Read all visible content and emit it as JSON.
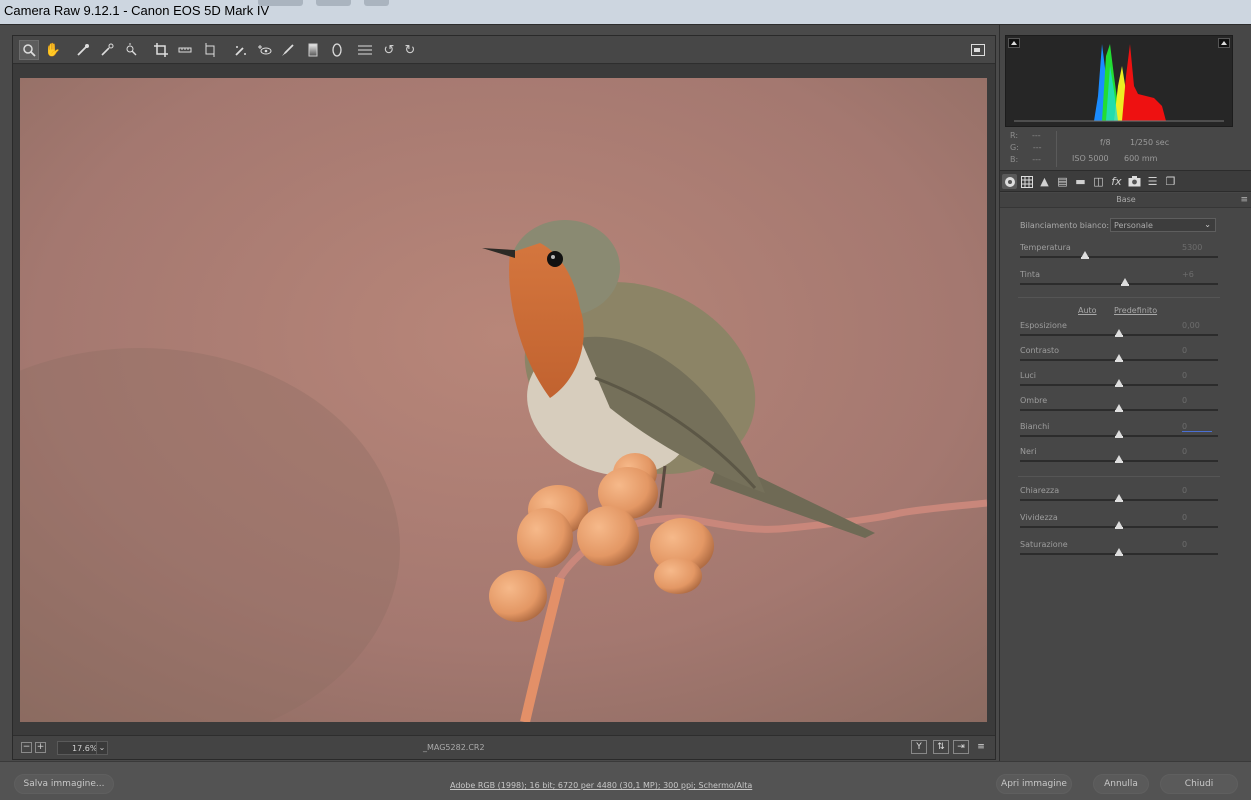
{
  "window": {
    "title": "Camera Raw 9.12.1  -  Canon EOS 5D Mark IV"
  },
  "toolbar": {
    "tools": [
      {
        "name": "zoom-tool",
        "icon": "magnifier-icon"
      },
      {
        "name": "hand-tool",
        "icon": "hand-icon"
      },
      {
        "name": "white-balance-tool",
        "icon": "eyedropper-icon"
      },
      {
        "name": "color-sampler-tool",
        "icon": "color-sampler-icon"
      },
      {
        "name": "targeted-adjustment-tool",
        "icon": "target-adjust-icon"
      },
      {
        "name": "crop-tool",
        "icon": "crop-icon"
      },
      {
        "name": "straighten-tool",
        "icon": "straighten-icon"
      },
      {
        "name": "transform-tool",
        "icon": "transform-icon"
      },
      {
        "name": "spot-removal-tool",
        "icon": "spot-removal-icon"
      },
      {
        "name": "red-eye-tool",
        "icon": "red-eye-icon"
      },
      {
        "name": "adjustment-brush-tool",
        "icon": "brush-icon"
      },
      {
        "name": "graduated-filter-tool",
        "icon": "graduated-filter-icon"
      },
      {
        "name": "radial-filter-tool",
        "icon": "radial-filter-icon"
      },
      {
        "name": "preferences-tool",
        "icon": "list-icon"
      },
      {
        "name": "rotate-left-tool",
        "icon": "rotate-ccw-icon"
      },
      {
        "name": "rotate-right-tool",
        "icon": "rotate-cw-icon"
      }
    ]
  },
  "preview": {
    "zoom": "17.6%",
    "filename": "_MAG5282.CR2"
  },
  "info": {
    "r_label": "R:",
    "g_label": "G:",
    "b_label": "B:",
    "r_value": "---",
    "g_value": "---",
    "b_value": "---",
    "aperture": "f/8",
    "shutter": "1/250 sec",
    "iso": "ISO 5000",
    "focal": "600 mm"
  },
  "panel": {
    "section_title": "Base",
    "wb_label": "Bilanciamento bianco:",
    "wb_value": "Personale",
    "auto_label": "Auto",
    "default_label": "Predefinito",
    "sliders": [
      {
        "label": "Temperatura",
        "value": "5300",
        "pos": 0.33
      },
      {
        "label": "Tinta",
        "value": "+6",
        "pos": 0.53
      },
      {
        "label": "Esposizione",
        "value": "0,00",
        "pos": 0.5
      },
      {
        "label": "Contrasto",
        "value": "0",
        "pos": 0.5
      },
      {
        "label": "Luci",
        "value": "0",
        "pos": 0.5
      },
      {
        "label": "Ombre",
        "value": "0",
        "pos": 0.5
      },
      {
        "label": "Bianchi",
        "value": "0",
        "pos": 0.5
      },
      {
        "label": "Neri",
        "value": "0",
        "pos": 0.5
      },
      {
        "label": "Chiarezza",
        "value": "0",
        "pos": 0.5
      },
      {
        "label": "Vividezza",
        "value": "0",
        "pos": 0.5
      },
      {
        "label": "Saturazione",
        "value": "0",
        "pos": 0.5
      }
    ]
  },
  "bottom": {
    "save_label": "Salva immagine...",
    "workflow_link": "Adobe RGB (1998); 16 bit; 6720 per 4480 (30,1 MP); 300 ppi; Schermo/Alta",
    "open_label": "Apri immagine",
    "cancel_label": "Annulla",
    "done_label": "Chiudi"
  },
  "colors": {
    "background": "#535353",
    "panel": "#474747",
    "histogram_bg": "#262626"
  }
}
